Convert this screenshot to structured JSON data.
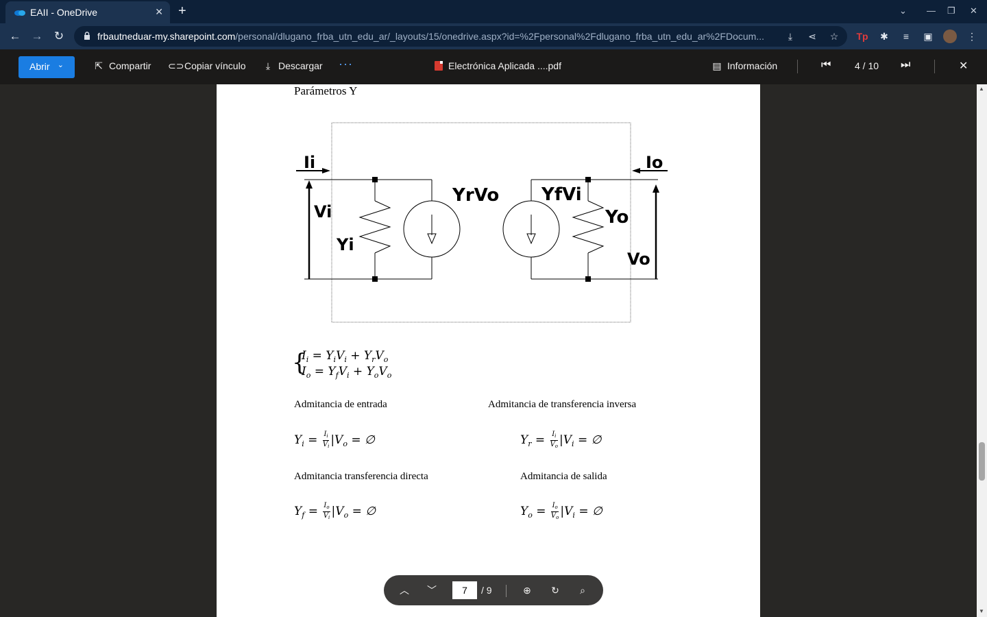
{
  "browser": {
    "tab_title": "EAII - OneDrive",
    "url_host": "frbautneduar-my.sharepoint.com",
    "url_path": "/personal/dlugano_frba_utn_edu_ar/_layouts/15/onedrive.aspx?id=%2Fpersonal%2Fdlugano_frba_utn_edu_ar%2FDocum...",
    "accent": "#1c3350"
  },
  "toolbar": {
    "open_label": "Abrir",
    "share_label": "Compartir",
    "copy_link_label": "Copiar vínculo",
    "download_label": "Descargar",
    "more_label": "···",
    "file_name": "Electrónica Aplicada ....pdf",
    "info_label": "Información",
    "pager": "4 / 10",
    "open_color": "#1a7de2"
  },
  "page": {
    "heading": "Parámetros Y",
    "circuit_labels": {
      "ii": "Ii",
      "io": "Io",
      "vi": "Vi",
      "yi": "Yi",
      "yrvo": "YrVo",
      "yfvi": "YfVi",
      "yo": "Yo",
      "vo": "Vo"
    },
    "labels": {
      "entrada": "Admitancia de entrada",
      "inversa": "Admitancia de transferencia inversa",
      "directa": "Admitancia transferencia directa",
      "salida": "Admitancia de salida"
    }
  },
  "float_nav": {
    "page_value": "7",
    "page_total": "/ 9"
  }
}
